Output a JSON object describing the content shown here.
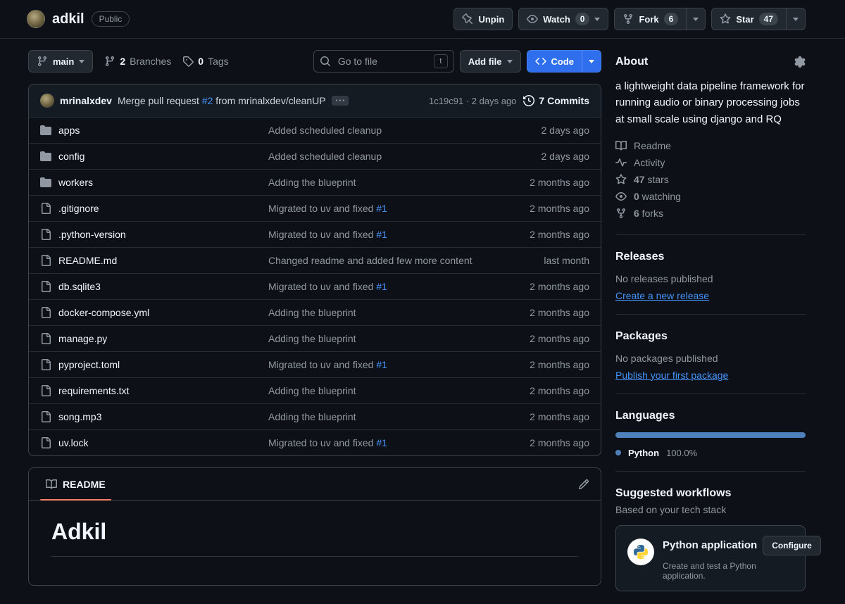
{
  "repo": {
    "name": "adkil",
    "visibility": "Public"
  },
  "actions": {
    "unpin": "Unpin",
    "watch": {
      "label": "Watch",
      "count": "0"
    },
    "fork": {
      "label": "Fork",
      "count": "6"
    },
    "star": {
      "label": "Star",
      "count": "47"
    }
  },
  "toolbar": {
    "branch": "main",
    "branches_count": "2",
    "branches_label": "Branches",
    "tags_count": "0",
    "tags_label": "Tags",
    "search_placeholder": "Go to file",
    "search_key": "t",
    "add_file_label": "Add file",
    "code_label": "Code"
  },
  "commit_bar": {
    "author": "mrinalxdev",
    "message": "Merge pull request ",
    "pr_link": "#2",
    "message_tail": " from mrinalxdev/cleanUP",
    "hash": "1c19c91",
    "dot": "·",
    "time": "2 days ago",
    "commits_count": "7",
    "commits_label": "Commits"
  },
  "files": [
    {
      "type": "folder",
      "name": "apps",
      "message": "Added scheduled cleanup",
      "link": "",
      "date": "2 days ago"
    },
    {
      "type": "folder",
      "name": "config",
      "message": "Added scheduled cleanup",
      "link": "",
      "date": "2 days ago"
    },
    {
      "type": "folder",
      "name": "workers",
      "message": "Adding the blueprint",
      "link": "",
      "date": "2 months ago"
    },
    {
      "type": "file",
      "name": ".gitignore",
      "message": "Migrated to uv and fixed ",
      "link": "#1",
      "date": "2 months ago"
    },
    {
      "type": "file",
      "name": ".python-version",
      "message": "Migrated to uv and fixed ",
      "link": "#1",
      "date": "2 months ago"
    },
    {
      "type": "file",
      "name": "README.md",
      "message": "Changed readme and added few more content",
      "link": "",
      "date": "last month"
    },
    {
      "type": "file",
      "name": "db.sqlite3",
      "message": "Migrated to uv and fixed ",
      "link": "#1",
      "date": "2 months ago"
    },
    {
      "type": "file",
      "name": "docker-compose.yml",
      "message": "Adding the blueprint",
      "link": "",
      "date": "2 months ago"
    },
    {
      "type": "file",
      "name": "manage.py",
      "message": "Adding the blueprint",
      "link": "",
      "date": "2 months ago"
    },
    {
      "type": "file",
      "name": "pyproject.toml",
      "message": "Migrated to uv and fixed ",
      "link": "#1",
      "date": "2 months ago"
    },
    {
      "type": "file",
      "name": "requirements.txt",
      "message": "Adding the blueprint",
      "link": "",
      "date": "2 months ago"
    },
    {
      "type": "file",
      "name": "song.mp3",
      "message": "Adding the blueprint",
      "link": "",
      "date": "2 months ago"
    },
    {
      "type": "file",
      "name": "uv.lock",
      "message": "Migrated to uv and fixed ",
      "link": "#1",
      "date": "2 months ago"
    }
  ],
  "readme": {
    "tab": "README",
    "heading": "Adkil"
  },
  "sidebar": {
    "about": {
      "title": "About",
      "description": "a lightweight data pipeline framework for running audio or binary processing jobs at small scale using django and RQ",
      "meta": [
        {
          "strong": "",
          "text": "Readme"
        },
        {
          "strong": "",
          "text": "Activity"
        },
        {
          "strong": "47",
          "text": " stars"
        },
        {
          "strong": "0",
          "text": " watching"
        },
        {
          "strong": "6",
          "text": " forks"
        }
      ]
    },
    "releases": {
      "title": "Releases",
      "empty": "No releases published",
      "link": "Create a new release"
    },
    "packages": {
      "title": "Packages",
      "empty": "No packages published",
      "link": "Publish your first package"
    },
    "languages": {
      "title": "Languages",
      "items": [
        {
          "name": "Python",
          "percent": "100.0%",
          "color": "#4e80b9"
        }
      ]
    },
    "workflows": {
      "title": "Suggested workflows",
      "subtitle": "Based on your tech stack",
      "card": {
        "name": "Python application",
        "button": "Configure",
        "description": "Create and test a Python application."
      }
    }
  },
  "colors": {
    "accent_link": "#4493f8",
    "primary_button": "#2f6fed",
    "readme_tab": "#f78166"
  }
}
